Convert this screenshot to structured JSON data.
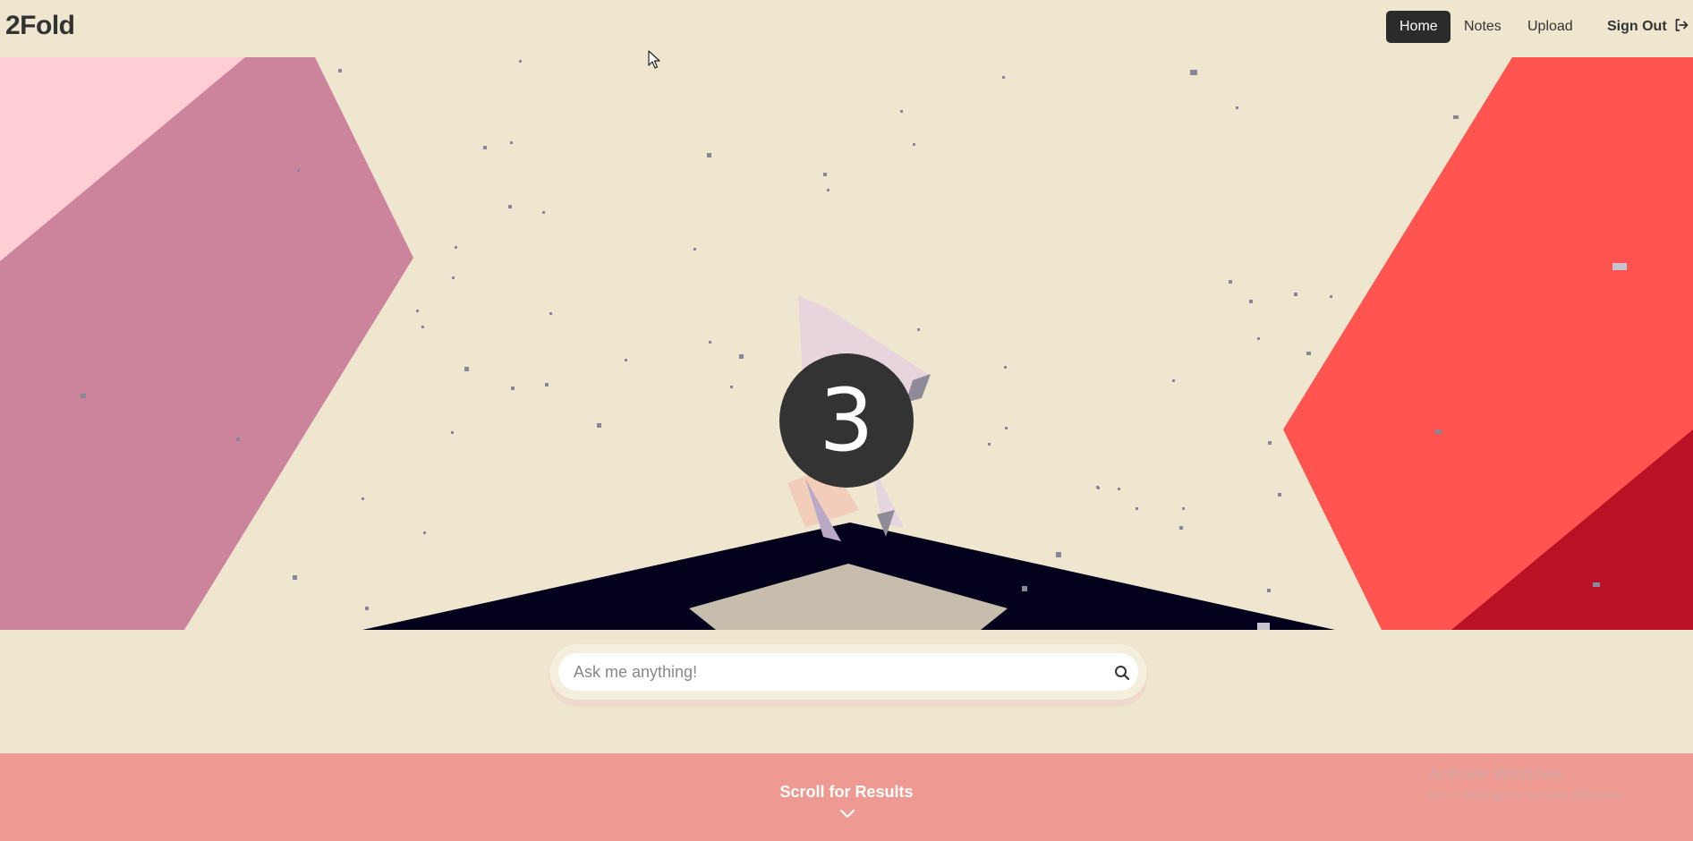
{
  "app": {
    "brand": "2Fold"
  },
  "nav": {
    "items": [
      {
        "label": "Home",
        "active": true
      },
      {
        "label": "Notes",
        "active": false
      },
      {
        "label": "Upload",
        "active": false
      }
    ],
    "sign_out_label": "Sign Out"
  },
  "scene": {
    "countdown": "3",
    "colors": {
      "background": "#EEE6CF",
      "left_shape": "#CC849D",
      "left_shape_light": "#FFCDD4",
      "right_shape": "#FF5450",
      "right_shape_dark": "#BA1124",
      "floor": "#02001A",
      "floor_inner": "#C6BDAD"
    }
  },
  "search": {
    "placeholder": "Ask me anything!",
    "value": ""
  },
  "results": {
    "label": "Scroll for Results"
  },
  "watermark": {
    "title": "Activate Windows",
    "subtitle": "Go to Settings to activate Windows."
  },
  "colors": {
    "accent": "#2B2B2B",
    "band": "#EE9A92",
    "text": "#333333"
  }
}
